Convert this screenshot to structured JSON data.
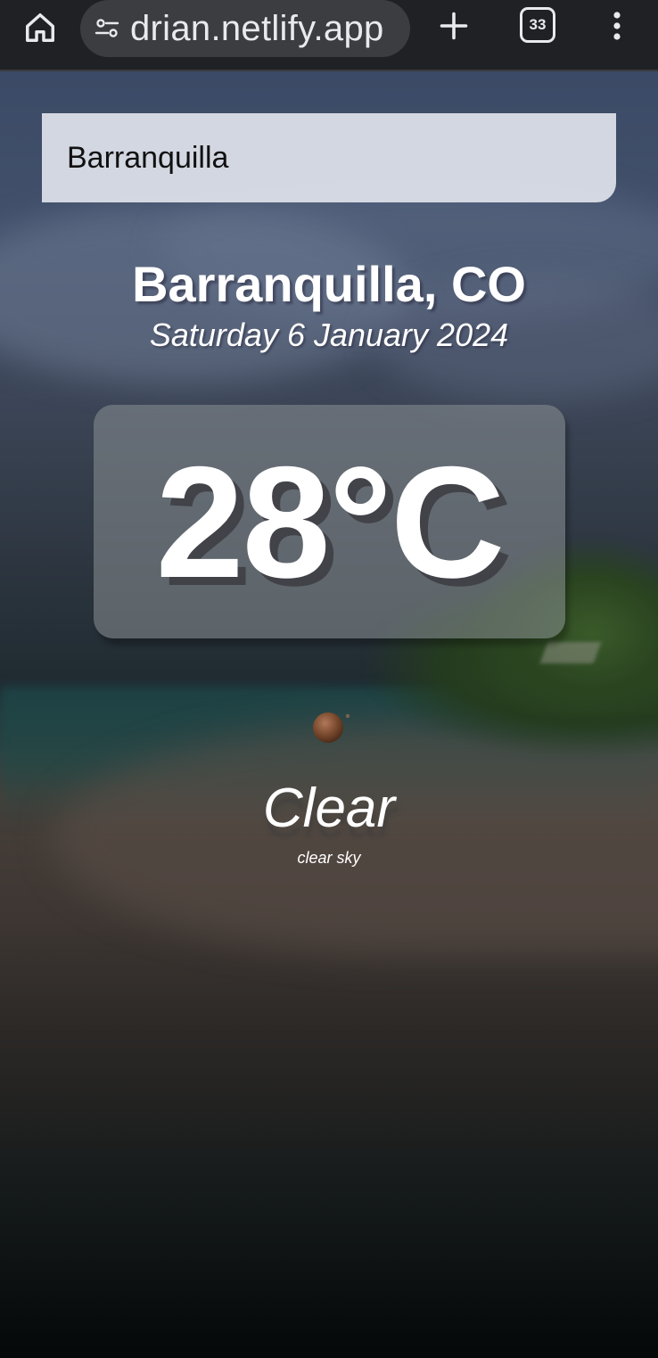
{
  "browser": {
    "url_visible": "drian.netlify.app",
    "tab_count": "33",
    "icons": {
      "home": "home-icon",
      "site_settings": "site-settings-icon",
      "new_tab": "plus-icon",
      "menu": "more-vert-icon"
    }
  },
  "app": {
    "search": {
      "value": "Barranquilla",
      "placeholder": ""
    },
    "location": "Barranquilla, CO",
    "date": "Saturday 6 January 2024",
    "temperature": "28°C",
    "weather_main": "Clear",
    "weather_description": "clear sky",
    "weather_icon": "clear-sky-icon"
  },
  "colors": {
    "browser_bar": "#202124",
    "url_pill": "#3c3d40",
    "search_box": "#dfe3eb",
    "text": "#ffffff"
  }
}
